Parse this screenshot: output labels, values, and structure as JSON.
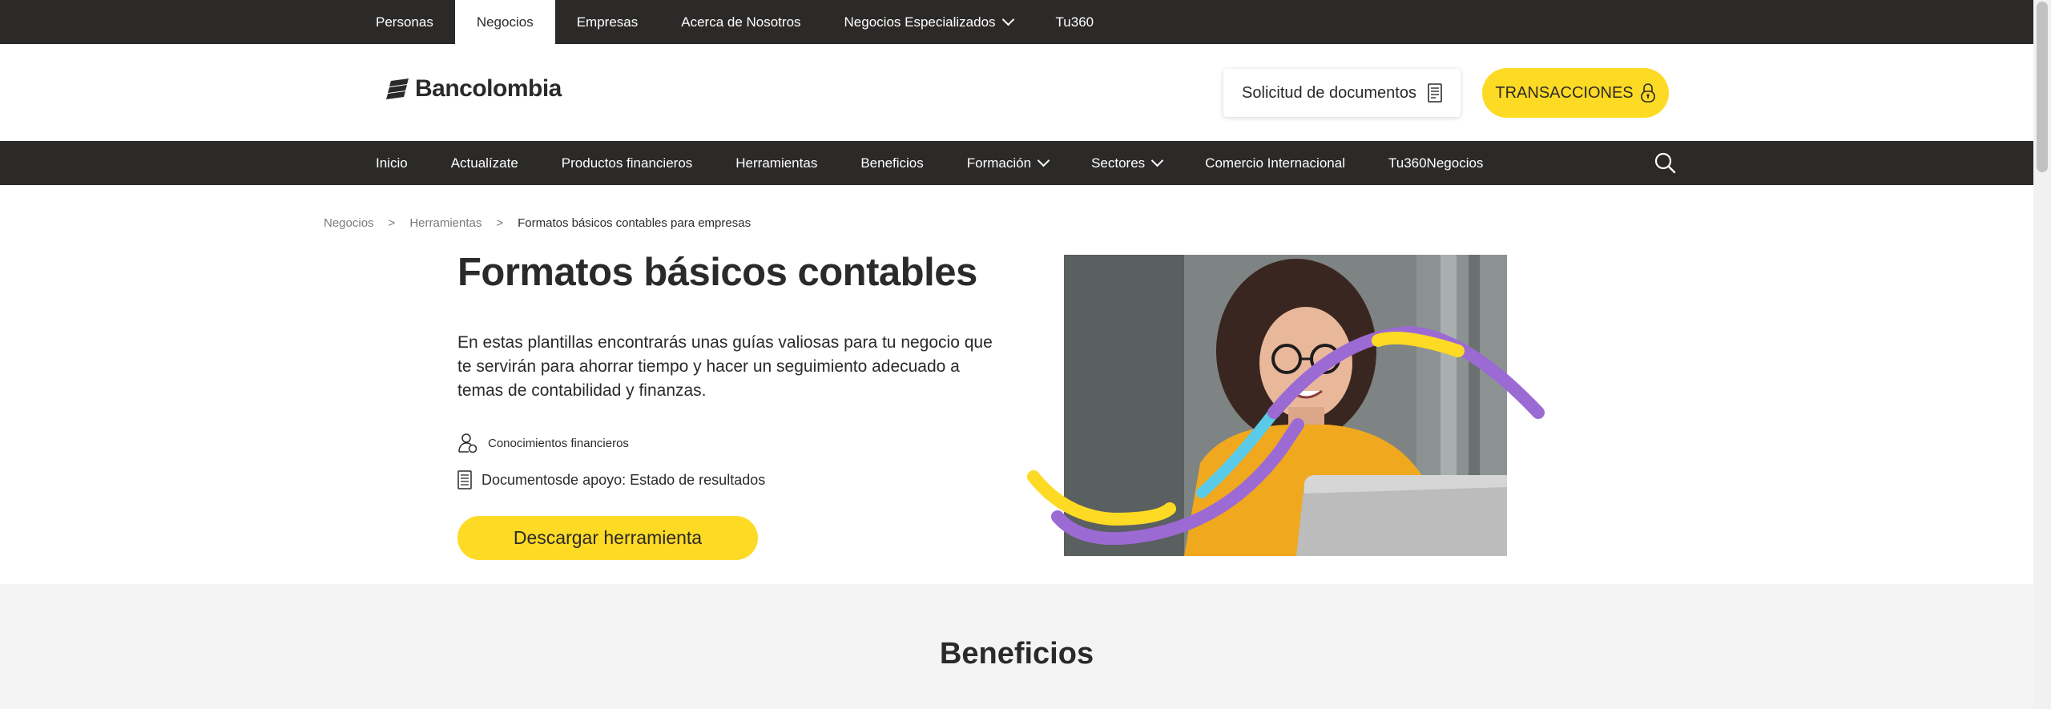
{
  "top_nav": {
    "items": [
      {
        "label": "Personas"
      },
      {
        "label": "Negocios",
        "active": true
      },
      {
        "label": "Empresas"
      },
      {
        "label": "Acerca de Nosotros"
      },
      {
        "label": "Negocios Especializados",
        "has_dropdown": true
      },
      {
        "label": "Tu360"
      }
    ]
  },
  "header": {
    "logo_text": "Bancolombia",
    "docs_button": "Solicitud de documentos",
    "transactions_button": "TRANSACCIONES"
  },
  "main_nav": {
    "items": [
      {
        "label": "Inicio"
      },
      {
        "label": "Actualízate"
      },
      {
        "label": "Productos financieros"
      },
      {
        "label": "Herramientas"
      },
      {
        "label": "Beneficios"
      },
      {
        "label": "Formación",
        "has_dropdown": true
      },
      {
        "label": "Sectores",
        "has_dropdown": true
      },
      {
        "label": "Comercio Internacional"
      },
      {
        "label": "Tu360Negocios"
      }
    ]
  },
  "breadcrumb": {
    "items": [
      "Negocios",
      "Herramientas",
      "Formatos básicos contables para empresas"
    ],
    "separator": ">"
  },
  "hero": {
    "title": "Formatos básicos contables",
    "description": "En estas plantillas encontrarás unas guías valiosas para tu negocio que te servirán para ahorrar tiempo y hacer un seguimiento adecuado a temas de contabilidad y finanzas.",
    "meta_category": "Conocimientos financieros",
    "meta_docs": "Documentosde apoyo: Estado de resultados",
    "download_button": "Descargar herramienta"
  },
  "benefits": {
    "title": "Beneficios"
  },
  "colors": {
    "dark": "#2c2a29",
    "brand_yellow": "#fdda24",
    "accent_purple": "#9c6ad3",
    "accent_cyan": "#59cbe8"
  }
}
